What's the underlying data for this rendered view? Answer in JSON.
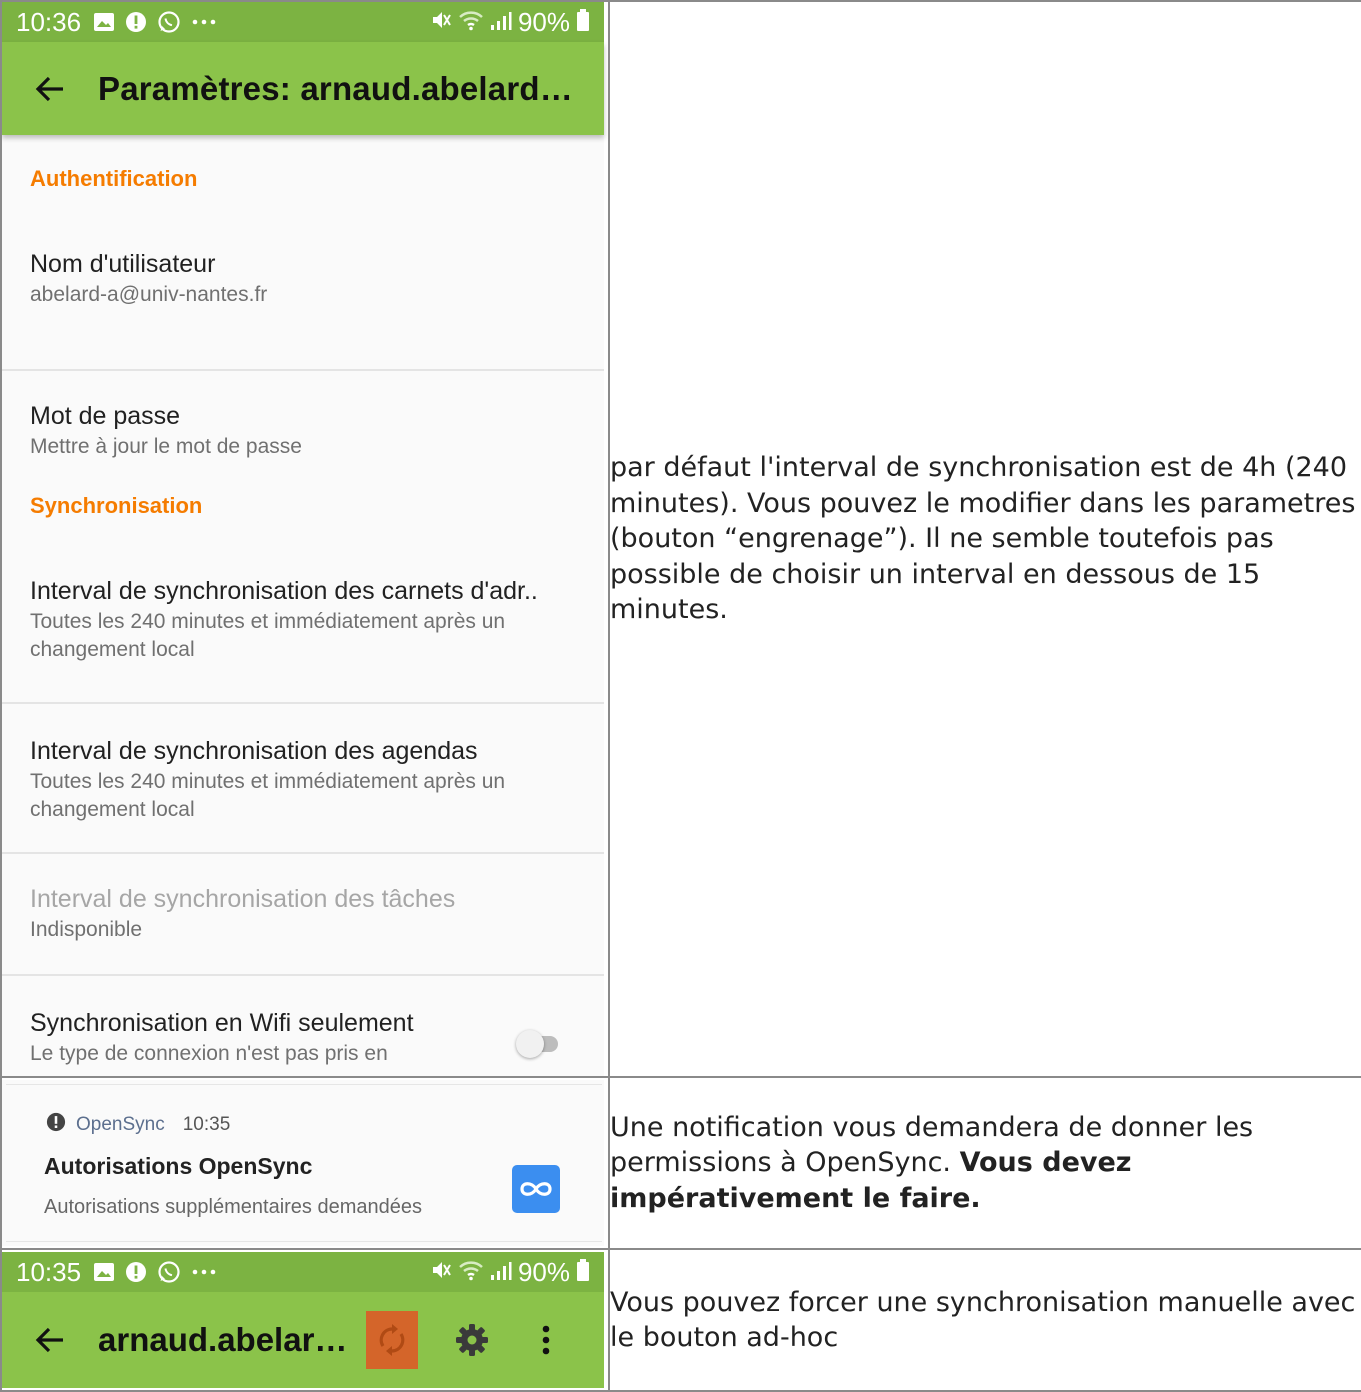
{
  "status_bar_top": {
    "time": "10:36",
    "battery": "90%"
  },
  "settings": {
    "title": "Paramètres: arnaud.abelard…",
    "sections": {
      "auth": "Authentification",
      "sync": "Synchronisation"
    },
    "prefs": {
      "username": {
        "title": "Nom d'utilisateur",
        "summary": "abelard-a@univ-nantes.fr"
      },
      "password": {
        "title": "Mot de passe",
        "summary": "Mettre à jour le mot de passe"
      },
      "contacts_interval": {
        "title": "Interval de synchronisation des carnets d'adr..",
        "summary": "Toutes les 240 minutes et immédiatement après un changement local"
      },
      "calendars_interval": {
        "title": "Interval de synchronisation des agendas",
        "summary": "Toutes les 240 minutes et immédiatement après un changement local"
      },
      "tasks_interval": {
        "title": "Interval de synchronisation des tâches",
        "summary": "Indisponible"
      },
      "wifi_only": {
        "title": "Synchronisation en Wifi seulement",
        "summary": "Le type de connexion n'est pas pris en",
        "enabled": false
      }
    }
  },
  "notification": {
    "app": "OpenSync",
    "time": "10:35",
    "title": "Autorisations OpenSync",
    "text": "Autorisations supplémentaires demandées"
  },
  "status_bar_bottom": {
    "time": "10:35",
    "battery": "90%"
  },
  "account_bar": {
    "title": "arnaud.abelar…"
  },
  "descriptions": {
    "row1": "par défaut l'interval de synchronisation est de 4h (240 minutes). Vous pouvez le modifier dans les parametres (bouton “engrenage”). Il ne semble toutefois pas possible de choisir un interval en dessous de 15 minutes.",
    "row2_plain": "Une notification vous demandera de donner les permissions à OpenSync. ",
    "row2_bold": "Vous devez impérativement le faire.",
    "row3": "Vous pouvez forcer une synchronisation manuelle avec le bouton ad-hoc"
  },
  "colors": {
    "status_bar": "#7cb342",
    "app_bar": "#8bc34a",
    "section_header": "#f57c00",
    "sync_button_highlight": "#d4652a",
    "notification_icon": "#3b8ef0"
  }
}
